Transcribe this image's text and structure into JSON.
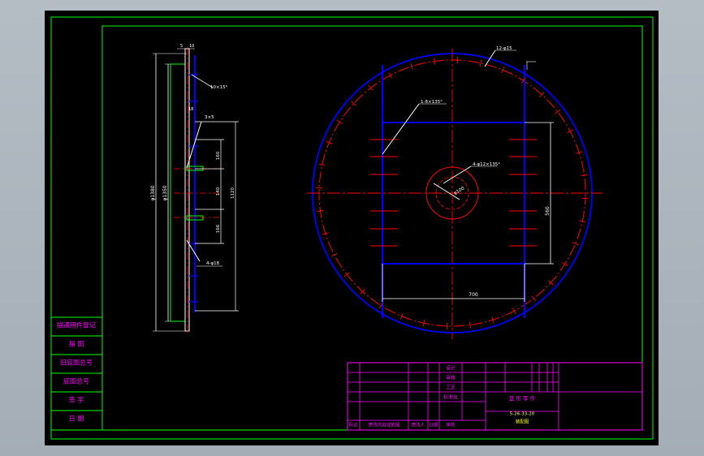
{
  "colors": {
    "background": "#000000",
    "frame": "#00ff00",
    "outline": "#ffffff",
    "geometry": "#0000ff",
    "centerline": "#ff0000",
    "dimension": "#ffffff",
    "annotation": "#ffff00",
    "title_block": "#ff00ff"
  },
  "side_view": {
    "dimensions": {
      "top_offset": "5",
      "top_gap": "10",
      "outer_diameter": "φ1380",
      "inner_diameter": "φ1350",
      "thickness": "18",
      "seg_a": "160",
      "seg_b": "140",
      "seg_c": "166",
      "height_total": "1120"
    },
    "callouts": {
      "top_right": "10×15°",
      "fillet": "3×5",
      "hole_note": "4-φ18"
    }
  },
  "front_view": {
    "callouts": {
      "rim_note": "12-φ15",
      "cross_note": "1-8×135°",
      "hub_note": "4-φ12×135°",
      "hub_diameter": "φ100"
    },
    "dimensions": {
      "frame_width": "700",
      "frame_height": "560"
    }
  },
  "left_tags": [
    "描通用件登记",
    "描 图",
    "旧底图总号",
    "底图总号",
    "签 字",
    "日 期"
  ],
  "title_block": {
    "right_labels": [
      "设计",
      "审核",
      "工艺",
      "标准化"
    ],
    "drawing_title": "盘 形 零 件",
    "drawing_code": "5-26-33-20",
    "drawing_name": "装配图",
    "bottom_labels": [
      "标记",
      "更改内容或依据",
      "更改人",
      "日期",
      "审核"
    ]
  }
}
